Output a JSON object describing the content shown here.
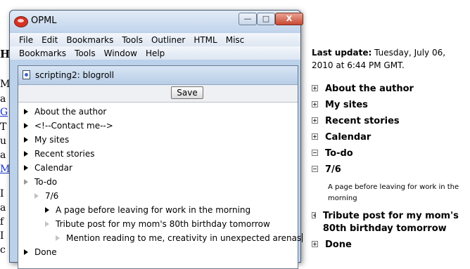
{
  "background_page": {
    "heading_fragment": "H",
    "lines": [
      "M",
      "a",
      "G",
      "T",
      "u",
      "a",
      "M",
      "I",
      "a",
      "f",
      "I",
      "c"
    ]
  },
  "right_page": {
    "last_update_label": "Last update:",
    "last_update_value": "Tuesday, July 06, 2010 at 6:44 PM GMT.",
    "items": [
      {
        "label": "About the author",
        "toggle": "plus"
      },
      {
        "label": "My sites",
        "toggle": "plus"
      },
      {
        "label": "Recent stories",
        "toggle": "plus"
      },
      {
        "label": "Calendar",
        "toggle": "plus"
      },
      {
        "label": "To-do",
        "toggle": "minus"
      },
      {
        "label": "7/6",
        "toggle": "minus"
      },
      {
        "label": "A page before leaving for work in the morning",
        "toggle": "none"
      },
      {
        "label": "Tribute post for my mom's 80th birthday tomorrow",
        "toggle": "plus"
      },
      {
        "label": "Done",
        "toggle": "plus"
      }
    ]
  },
  "app_window": {
    "title": "OPML",
    "controls": {
      "minimize": "—",
      "maximize": "□",
      "close": "X"
    },
    "menu_row1": [
      "File",
      "Edit",
      "Bookmarks",
      "Tools",
      "Outliner",
      "HTML",
      "Misc"
    ],
    "menu_row2": [
      "Bookmarks",
      "Tools",
      "Window",
      "Help"
    ],
    "document": {
      "title": "scripting2: blogroll",
      "save_label": "Save",
      "outline": [
        {
          "text": "About the author",
          "level": 0,
          "expander": "filled"
        },
        {
          "text": "<!--Contact me-->",
          "level": 0,
          "expander": "filled"
        },
        {
          "text": "My sites",
          "level": 0,
          "expander": "filled"
        },
        {
          "text": "Recent stories",
          "level": 0,
          "expander": "filled"
        },
        {
          "text": "Calendar",
          "level": 0,
          "expander": "filled"
        },
        {
          "text": "To-do",
          "level": 0,
          "expander": "expanded"
        },
        {
          "text": "7/6",
          "level": 1,
          "expander": "expanded"
        },
        {
          "text": "A page before leaving for work in the morning",
          "level": 2,
          "expander": "filled"
        },
        {
          "text": "Tribute post for my mom's 80th birthday tomorrow",
          "level": 2,
          "expander": "expanded"
        },
        {
          "text": "Mention reading to me, creativity in unexpected arenas",
          "level": 3,
          "expander": "expanded"
        },
        {
          "text": "Done",
          "level": 0,
          "expander": "filled"
        }
      ]
    }
  },
  "colors": {
    "window_frame": "#bcd1ea",
    "close_button": "#c94a32",
    "link": "#1a33cc"
  }
}
